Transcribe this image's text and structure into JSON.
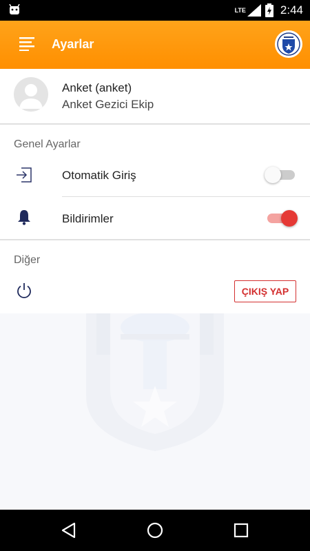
{
  "status_bar": {
    "network": "LTE",
    "time": "2:44",
    "icons": [
      "android-icon",
      "signal-icon",
      "battery-icon"
    ]
  },
  "app_bar": {
    "title": "Ayarlar",
    "menu_icon": "menu-icon",
    "logo": "municipality-logo",
    "color": "#ff9800"
  },
  "profile": {
    "name": "Anket (anket)",
    "team": "Anket Gezici Ekip"
  },
  "general": {
    "title": "Genel Ayarlar",
    "auto_login": {
      "label": "Otomatik Giriş",
      "enabled": false,
      "icon": "login-icon"
    },
    "notifications": {
      "label": "Bildirimler",
      "enabled": true,
      "icon": "bell-icon"
    }
  },
  "other": {
    "title": "Diğer",
    "power_icon": "power-icon",
    "logout_label": "ÇIKIŞ YAP",
    "accent": "#d32f2f"
  },
  "nav_bar": {
    "icons": [
      "back-icon",
      "home-icon",
      "recents-icon"
    ]
  }
}
